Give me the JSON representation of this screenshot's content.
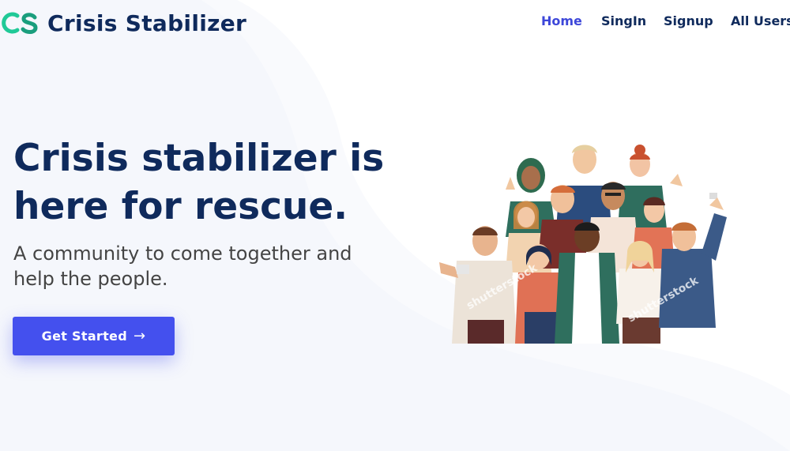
{
  "brand": {
    "name": "Crisis Stabilizer",
    "logo_icon": "cs-monogram-icon",
    "logo_colors": [
      "#20c997",
      "#1a9e7d"
    ]
  },
  "nav": {
    "items": [
      {
        "label": "Home",
        "active": true
      },
      {
        "label": "SingIn"
      },
      {
        "label": "Signup"
      },
      {
        "label": "All Users"
      }
    ]
  },
  "hero": {
    "title": "Crisis stabilizer is here for rescue.",
    "subtitle": "A community to come together and help the people.",
    "cta_label": "Get Started",
    "cta_icon": "arrow-right-icon",
    "illustration": "group-of-diverse-people-waving-illustration",
    "watermark": "shutterstock"
  },
  "colors": {
    "primary": "#4450ee",
    "heading": "#0f2a5c",
    "active_link": "#3d47d9",
    "background_tint": "#f5f7fc"
  }
}
